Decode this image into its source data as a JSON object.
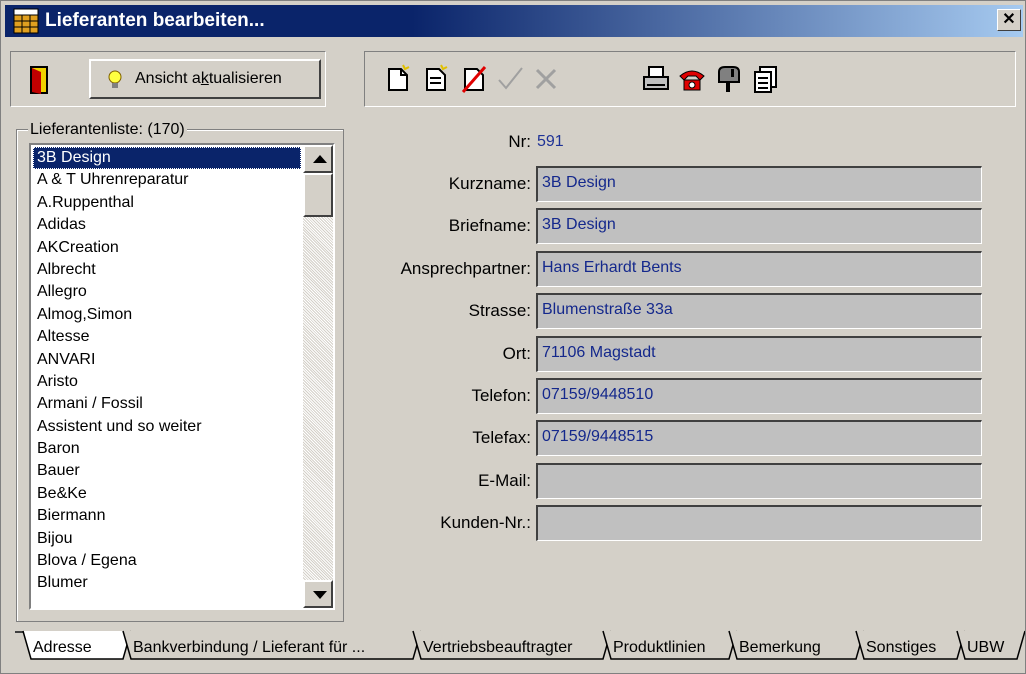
{
  "window": {
    "title": "Lieferanten bearbeiten...",
    "close_glyph": "✕"
  },
  "toolbar": {
    "refresh_label_pre": "Ansicht a",
    "refresh_label_ul": "k",
    "refresh_label_post": "tualisieren",
    "icons": [
      "new-document-icon",
      "copy-document-icon",
      "delete-icon",
      "confirm-check-icon",
      "cancel-x-icon",
      "print-icon",
      "phone-icon",
      "mailbox-icon",
      "report-icon"
    ]
  },
  "list": {
    "caption": "Lieferantenliste: (170)",
    "items": [
      "3B Design",
      "A & T Uhrenreparatur",
      "A.Ruppenthal",
      "Adidas",
      "AKCreation",
      "Albrecht",
      "Allegro",
      "Almog,Simon",
      "Altesse",
      "ANVARI",
      "Aristo",
      "Armani / Fossil",
      "Assistent und so weiter",
      "Baron",
      "Bauer",
      "Be&Ke",
      "Biermann",
      "Bijou",
      "Blova / Egena",
      "Blumer"
    ],
    "selected_index": 0
  },
  "detail": {
    "nr_label": "Nr:",
    "nr_value": "591",
    "fields": [
      {
        "label": "Kurzname:",
        "value": "3B Design"
      },
      {
        "label": "Briefname:",
        "value": "3B Design"
      },
      {
        "label": "Ansprechpartner:",
        "value": "Hans Erhardt Bents"
      },
      {
        "label": "Strasse:",
        "value": "Blumenstraße 33a"
      },
      {
        "label": "Ort:",
        "value": "71106 Magstadt"
      },
      {
        "label": "Telefon:",
        "value": "07159/9448510"
      },
      {
        "label": "Telefax:",
        "value": "07159/9448515"
      },
      {
        "label": "E-Mail:",
        "value": ""
      },
      {
        "label": "Kunden-Nr.:",
        "value": ""
      }
    ]
  },
  "tabs": [
    "Adresse",
    "Bankverbindung / Lieferant für ...",
    "Vertriebsbeauftragter",
    "Produktlinien",
    "Bemerkung",
    "Sonstiges",
    "UBW"
  ],
  "colors": {
    "titlebar": "#0a246a",
    "selection": "#0a246a",
    "value_text": "#14288c"
  }
}
